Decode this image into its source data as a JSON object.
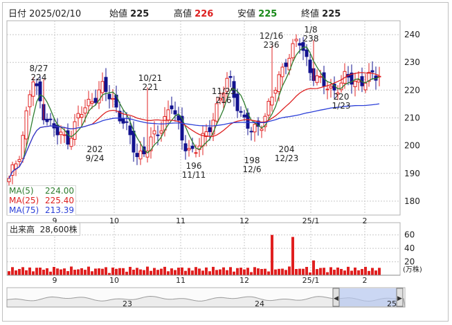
{
  "header": {
    "date_label": "日付",
    "date": "2025/02/10",
    "open_label": "始値",
    "open": "225",
    "high_label": "高値",
    "high": "226",
    "low_label": "安値",
    "low": "225",
    "close_label": "終値",
    "close": "225"
  },
  "legend": {
    "ma5_label": "MA(5)",
    "ma5": "224.00",
    "ma25_label": "MA(25)",
    "ma25": "225.40",
    "ma75_label": "MA(75)",
    "ma75": "213.39"
  },
  "volume": {
    "label": "出来高",
    "value": "28,600株",
    "unit": "(万株)"
  },
  "colors": {
    "up": "#e02020",
    "down": "#12128f",
    "ma5": "#2e7d2e",
    "ma25": "#dd2020",
    "ma75": "#2b3fd8",
    "high": "#dd2020",
    "low": "#1a8a1a",
    "grid": "#c8c8c8",
    "nav_fill": "#b7c7ef"
  },
  "chart_data": [
    {
      "type": "candlestick",
      "ylim": [
        175,
        245
      ],
      "yticks": [
        180,
        190,
        200,
        210,
        220,
        230,
        240
      ],
      "x_ticks": [
        "9",
        "10",
        "11",
        "12",
        "25/1",
        "2"
      ],
      "grid": true,
      "candles_start_low": 187,
      "candles_count": 108,
      "annotations": [
        {
          "date": "8/27",
          "value": "224",
          "position": "above"
        },
        {
          "date": "9/24",
          "value": "202",
          "position": "below"
        },
        {
          "date": "10/21",
          "value": "221",
          "position": "above"
        },
        {
          "date": "11/11",
          "value": "196",
          "position": "below"
        },
        {
          "date": "11/25",
          "value": "216",
          "position": "above"
        },
        {
          "date": "12/6",
          "value": "198",
          "position": "below"
        },
        {
          "date": "12/16",
          "value": "236",
          "position": "above"
        },
        {
          "date": "12/23",
          "value": "204",
          "position": "below"
        },
        {
          "date": "1/8",
          "value": "238",
          "position": "above"
        },
        {
          "date": "1/23",
          "value": "220",
          "position": "below"
        }
      ],
      "key_closes": [
        187,
        199,
        224,
        212,
        205,
        202,
        210,
        216,
        221,
        216,
        208,
        196,
        200,
        205,
        216,
        201,
        198,
        203,
        215,
        224,
        212,
        204,
        210,
        220,
        232,
        238,
        228,
        222,
        220,
        224,
        223,
        224,
        225
      ],
      "ma_series": [
        "MA(5)",
        "MA(25)",
        "MA(75)"
      ]
    },
    {
      "type": "bar",
      "ylabel": "(万株)",
      "ylim": [
        0,
        70
      ],
      "yticks": [
        20,
        40,
        60
      ],
      "x_ticks": [
        "9",
        "10",
        "11",
        "12",
        "25/1",
        "2"
      ],
      "spikes": [
        {
          "date": "12/16",
          "value": 60
        },
        {
          "date": "12/23",
          "value": 57
        },
        {
          "date": "1/8",
          "value": 22
        }
      ]
    },
    {
      "type": "area",
      "x_ticks": [
        "23",
        "24",
        "25"
      ]
    }
  ]
}
